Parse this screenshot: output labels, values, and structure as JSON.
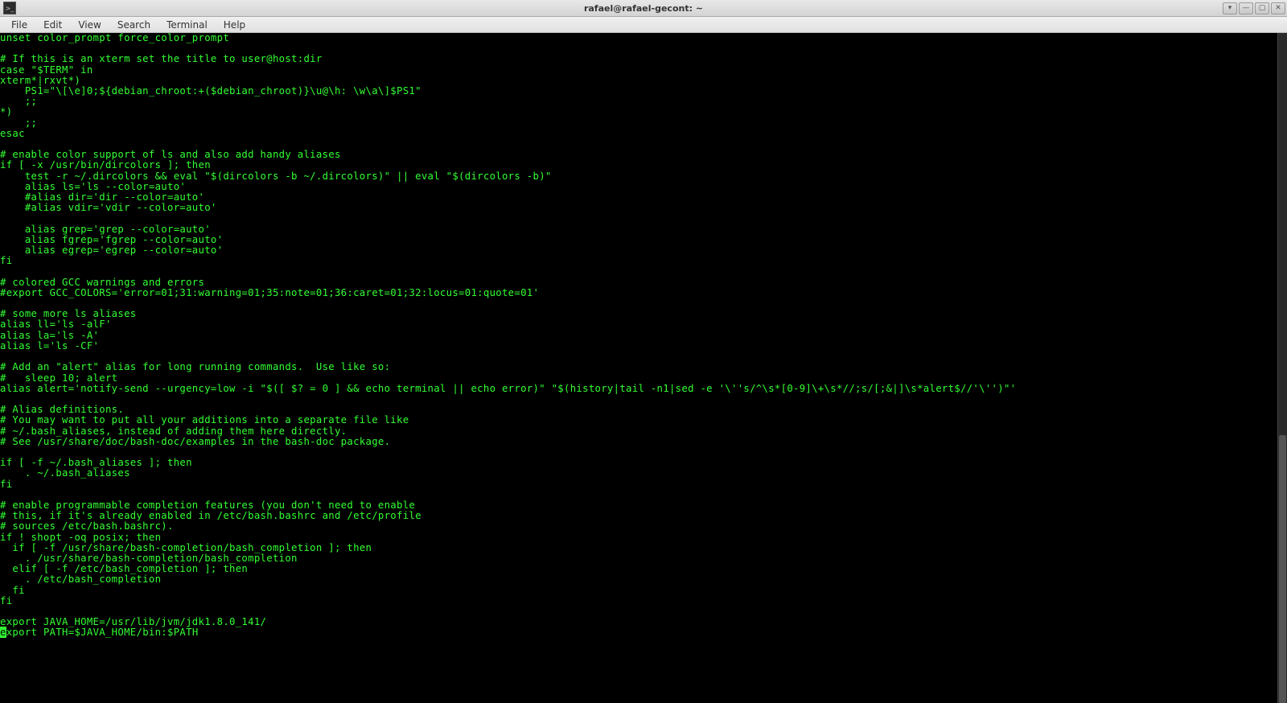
{
  "window": {
    "title": "rafael@rafael-gecont: ~"
  },
  "menubar": {
    "items": [
      "File",
      "Edit",
      "View",
      "Search",
      "Terminal",
      "Help"
    ]
  },
  "terminal": {
    "lines": [
      "unset color_prompt force_color_prompt",
      "",
      "# If this is an xterm set the title to user@host:dir",
      "case \"$TERM\" in",
      "xterm*|rxvt*)",
      "    PS1=\"\\[\\e]0;${debian_chroot:+($debian_chroot)}\\u@\\h: \\w\\a\\]$PS1\"",
      "    ;;",
      "*)",
      "    ;;",
      "esac",
      "",
      "# enable color support of ls and also add handy aliases",
      "if [ -x /usr/bin/dircolors ]; then",
      "    test -r ~/.dircolors && eval \"$(dircolors -b ~/.dircolors)\" || eval \"$(dircolors -b)\"",
      "    alias ls='ls --color=auto'",
      "    #alias dir='dir --color=auto'",
      "    #alias vdir='vdir --color=auto'",
      "",
      "    alias grep='grep --color=auto'",
      "    alias fgrep='fgrep --color=auto'",
      "    alias egrep='egrep --color=auto'",
      "fi",
      "",
      "# colored GCC warnings and errors",
      "#export GCC_COLORS='error=01;31:warning=01;35:note=01;36:caret=01;32:locus=01:quote=01'",
      "",
      "# some more ls aliases",
      "alias ll='ls -alF'",
      "alias la='ls -A'",
      "alias l='ls -CF'",
      "",
      "# Add an \"alert\" alias for long running commands.  Use like so:",
      "#   sleep 10; alert",
      "alias alert='notify-send --urgency=low -i \"$([ $? = 0 ] && echo terminal || echo error)\" \"$(history|tail -n1|sed -e '\\''s/^\\s*[0-9]\\+\\s*//;s/[;&|]\\s*alert$//'\\'')\"'",
      "",
      "# Alias definitions.",
      "# You may want to put all your additions into a separate file like",
      "# ~/.bash_aliases, instead of adding them here directly.",
      "# See /usr/share/doc/bash-doc/examples in the bash-doc package.",
      "",
      "if [ -f ~/.bash_aliases ]; then",
      "    . ~/.bash_aliases",
      "fi",
      "",
      "# enable programmable completion features (you don't need to enable",
      "# this, if it's already enabled in /etc/bash.bashrc and /etc/profile",
      "# sources /etc/bash.bashrc).",
      "if ! shopt -oq posix; then",
      "  if [ -f /usr/share/bash-completion/bash_completion ]; then",
      "    . /usr/share/bash-completion/bash_completion",
      "  elif [ -f /etc/bash_completion ]; then",
      "    . /etc/bash_completion",
      "  fi",
      "fi",
      "",
      "export JAVA_HOME=/usr/lib/jvm/jdk1.8.0_141/"
    ],
    "last_line_prefix": "e",
    "last_line_rest": "xport PATH=$JAVA_HOME/bin:$PATH"
  }
}
